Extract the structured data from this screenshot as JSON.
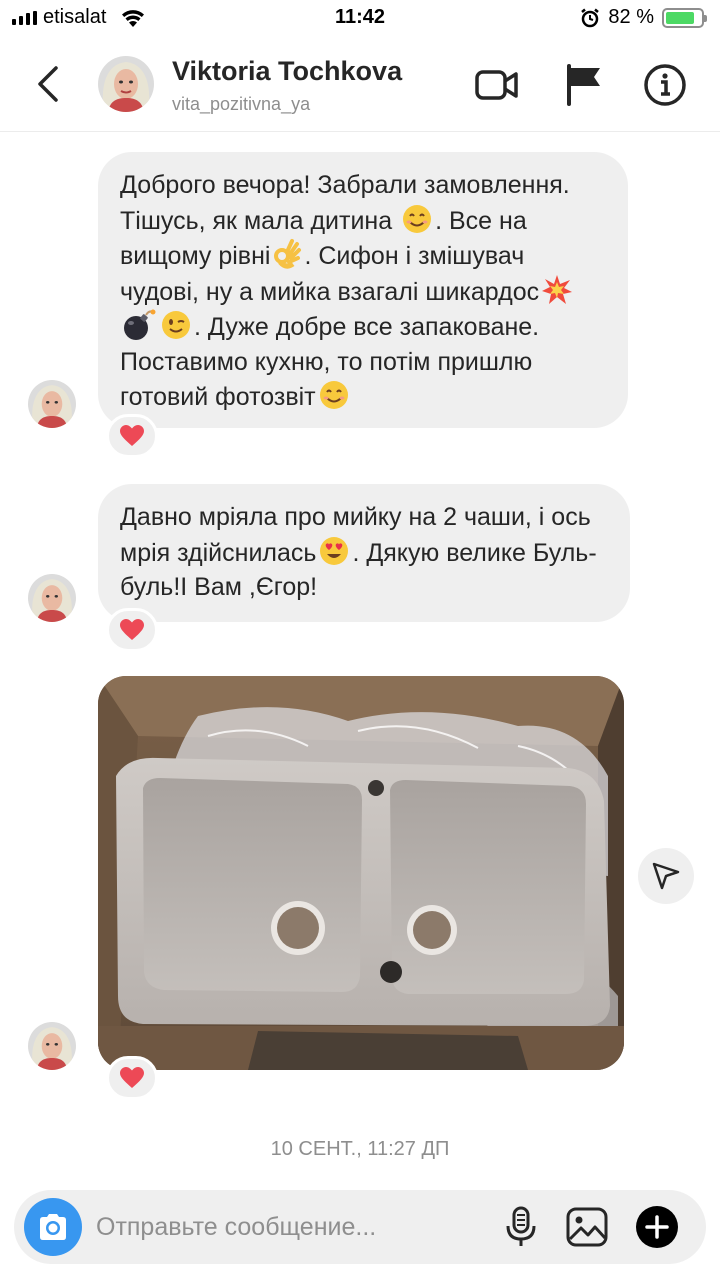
{
  "status_bar": {
    "carrier": "etisalat",
    "time": "11:42",
    "battery_percent": "82 %",
    "battery_level": 0.82
  },
  "header": {
    "name": "Viktoria Tochkova",
    "username": "vita_pozitivna_ya",
    "icons": [
      "back-icon",
      "video-call-icon",
      "flag-icon",
      "info-icon"
    ]
  },
  "messages": [
    {
      "segments": [
        "Доброго вечора! Забрали замовлення. Тішусь, як мала дитина ",
        ". Все на вищому рівні",
        ". Сифон і змішувач чудові, ну а мийка взагалі шикардос",
        ". Дуже добре все запаковане. Поставимо кухню, то потім пришлю готовий фотозвіт"
      ],
      "reaction": "heart"
    },
    {
      "segments": [
        "Давно мріяла про мийку на 2 чаши, і ось мрія здійснилась",
        ". Дякую велике Буль-буль!І Вам ,Єгор!"
      ],
      "reaction": "heart"
    },
    {
      "type": "photo",
      "description_icon": "sink-photo",
      "reaction": "heart"
    }
  ],
  "timestamp": "10 СЕНТ., 11:27 ДП",
  "composer": {
    "placeholder": "Отправьте сообщение..."
  },
  "colors": {
    "bubble": "#efefef",
    "accent": "#3897f0",
    "heart": "#ed4956",
    "battery": "#4cd964"
  }
}
